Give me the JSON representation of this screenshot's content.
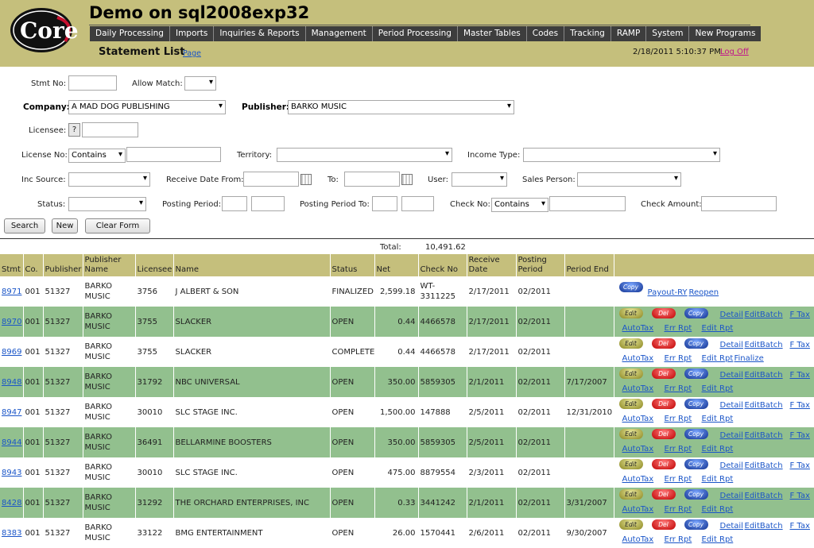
{
  "app": {
    "logo_text": "Core",
    "title": "Demo on sql2008exp32",
    "nav": [
      "Daily Processing",
      "Imports",
      "Inquiries & Reports",
      "Management",
      "Period Processing",
      "Master Tables",
      "Codes",
      "Tracking",
      "RAMP",
      "System",
      "New Programs"
    ],
    "page_title": "Statement List",
    "page_link": "Page",
    "datetime": "2/18/2011 5:10:37 PM",
    "logoff": "Log Off"
  },
  "form": {
    "stmt_no_label": "Stmt No:",
    "stmt_no_value": "",
    "allow_match_label": "Allow Match:",
    "allow_match_value": "",
    "company_label": "Company:",
    "company_value": "A MAD DOG PUBLISHING",
    "publisher_label": "Publisher:",
    "publisher_value": "BARKO MUSIC",
    "licensee_label": "Licensee:",
    "licensee_help": "?",
    "licensee_value": "",
    "license_no_label": "License No:",
    "license_no_mode": "Contains",
    "license_no_value": "",
    "territory_label": "Territory:",
    "territory_value": "",
    "income_type_label": "Income Type:",
    "income_type_value": "",
    "inc_source_label": "Inc Source:",
    "inc_source_value": "",
    "receive_from_label": "Receive Date From:",
    "receive_from_value": "",
    "to_label": "To:",
    "to_value": "",
    "user_label": "User:",
    "user_value": "",
    "sales_person_label": "Sales Person:",
    "sales_person_value": "",
    "status_label": "Status:",
    "status_value": "",
    "posting_period_label": "Posting Period:",
    "posting_period_to_label": "Posting Period To:",
    "check_no_label": "Check No:",
    "check_no_mode": "Contains",
    "check_no_value": "",
    "check_amount_label": "Check Amount:",
    "check_amount_value": "",
    "search_btn": "Search",
    "new_btn": "New",
    "clear_btn": "Clear Form"
  },
  "totals": {
    "label": "Total:",
    "value": "10,491.62"
  },
  "table": {
    "columns": [
      "Stmt",
      "Co.",
      "Publisher",
      "Publisher Name",
      "Licensee",
      "Name",
      "Status",
      "Net",
      "Check No",
      "Receive Date",
      "Posting Period",
      "Period End",
      ""
    ],
    "rows": [
      {
        "stmt": "8971",
        "co": "001",
        "publisher": "51327",
        "pub_name": "BARKO MUSIC",
        "licensee": "3756",
        "name": "J ALBERT & SON",
        "status": "FINALIZED",
        "net": "2,599.18",
        "check_no": "WT-3311225",
        "receive": "2/17/2011",
        "posting": "02/2011",
        "period_end": "",
        "style": "finalized"
      },
      {
        "stmt": "8970",
        "co": "001",
        "publisher": "51327",
        "pub_name": "BARKO MUSIC",
        "licensee": "3755",
        "name": "SLACKER",
        "status": "OPEN",
        "net": "0.44",
        "check_no": "4466578",
        "receive": "2/17/2011",
        "posting": "02/2011",
        "period_end": "",
        "style": "open"
      },
      {
        "stmt": "8969",
        "co": "001",
        "publisher": "51327",
        "pub_name": "BARKO MUSIC",
        "licensee": "3755",
        "name": "SLACKER",
        "status": "COMPLETE",
        "net": "0.44",
        "check_no": "4466578",
        "receive": "2/17/2011",
        "posting": "02/2011",
        "period_end": "",
        "style": "complete"
      },
      {
        "stmt": "8948",
        "co": "001",
        "publisher": "51327",
        "pub_name": "BARKO MUSIC",
        "licensee": "31792",
        "name": "NBC UNIVERSAL",
        "status": "OPEN",
        "net": "350.00",
        "check_no": "5859305",
        "receive": "2/1/2011",
        "posting": "02/2011",
        "period_end": "7/17/2007",
        "style": "open"
      },
      {
        "stmt": "8947",
        "co": "001",
        "publisher": "51327",
        "pub_name": "BARKO MUSIC",
        "licensee": "30010",
        "name": "SLC STAGE INC.",
        "status": "OPEN",
        "net": "1,500.00",
        "check_no": "147888",
        "receive": "2/5/2011",
        "posting": "02/2011",
        "period_end": "12/31/2010",
        "style": "open"
      },
      {
        "stmt": "8944",
        "co": "001",
        "publisher": "51327",
        "pub_name": "BARKO MUSIC",
        "licensee": "36491",
        "name": "BELLARMINE BOOSTERS",
        "status": "OPEN",
        "net": "350.00",
        "check_no": "5859305",
        "receive": "2/5/2011",
        "posting": "02/2011",
        "period_end": "",
        "style": "open"
      },
      {
        "stmt": "8943",
        "co": "001",
        "publisher": "51327",
        "pub_name": "BARKO MUSIC",
        "licensee": "30010",
        "name": "SLC STAGE INC.",
        "status": "OPEN",
        "net": "475.00",
        "check_no": "8879554",
        "receive": "2/3/2011",
        "posting": "02/2011",
        "period_end": "",
        "style": "open"
      },
      {
        "stmt": "8428",
        "co": "001",
        "publisher": "51327",
        "pub_name": "BARKO MUSIC",
        "licensee": "31292",
        "name": "THE ORCHARD ENTERPRISES, INC",
        "status": "OPEN",
        "net": "0.33",
        "check_no": "3441242",
        "receive": "2/1/2011",
        "posting": "02/2011",
        "period_end": "3/31/2007",
        "style": "open"
      },
      {
        "stmt": "8383",
        "co": "001",
        "publisher": "51327",
        "pub_name": "BARKO MUSIC",
        "licensee": "33122",
        "name": "BMG ENTERTAINMENT",
        "status": "OPEN",
        "net": "26.00",
        "check_no": "1570441",
        "receive": "2/6/2011",
        "posting": "02/2011",
        "period_end": "9/30/2007",
        "style": "open"
      }
    ],
    "actions": {
      "edit": "Edit",
      "del": "Del",
      "copy": "Copy",
      "payout": "Payout-RY",
      "reopen": "Reopen",
      "detail": "Detail",
      "editbatch": "EditBatch",
      "ftax": "F Tax",
      "autotax": "AutoTax",
      "errrpt": "Err Rpt",
      "editrpt": "Edit Rpt",
      "finalize": "Finalize"
    }
  },
  "colors": {
    "header_bg": "#c5bf7c",
    "row_alt": "#92c08e",
    "nav_bg": "#3d3d3d",
    "link": "#1a55c8",
    "logoff": "#c0148c"
  }
}
